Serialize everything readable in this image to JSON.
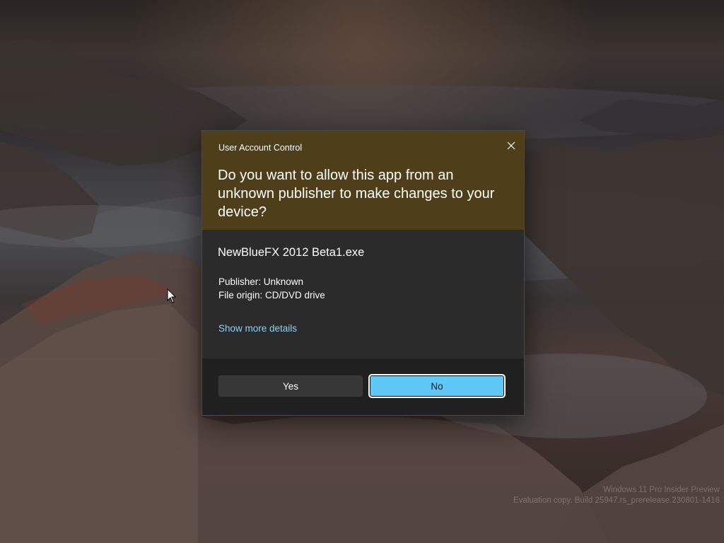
{
  "dialog": {
    "caption": "User Account Control",
    "question": "Do you want to allow this app from an unknown publisher to make changes to your device?",
    "app_name": "NewBlueFX 2012 Beta1.exe",
    "publisher_line": "Publisher: Unknown",
    "origin_line": "File origin: CD/DVD drive",
    "details_link": "Show more details",
    "yes_label": "Yes",
    "no_label": "No",
    "close_icon": "close-icon",
    "colors": {
      "header_bg": "#4e3f1a",
      "body_bg": "#2b2b2b",
      "footer_bg": "#202020",
      "link": "#8cd1f2",
      "primary_button": "#60c8f7"
    }
  },
  "watermark": {
    "line1": "Windows 11 Pro Insider Preview",
    "line2": "Evaluation copy. Build 25947.rs_prerelease.230801-1416"
  },
  "cursor_icon": "mouse-pointer-icon"
}
